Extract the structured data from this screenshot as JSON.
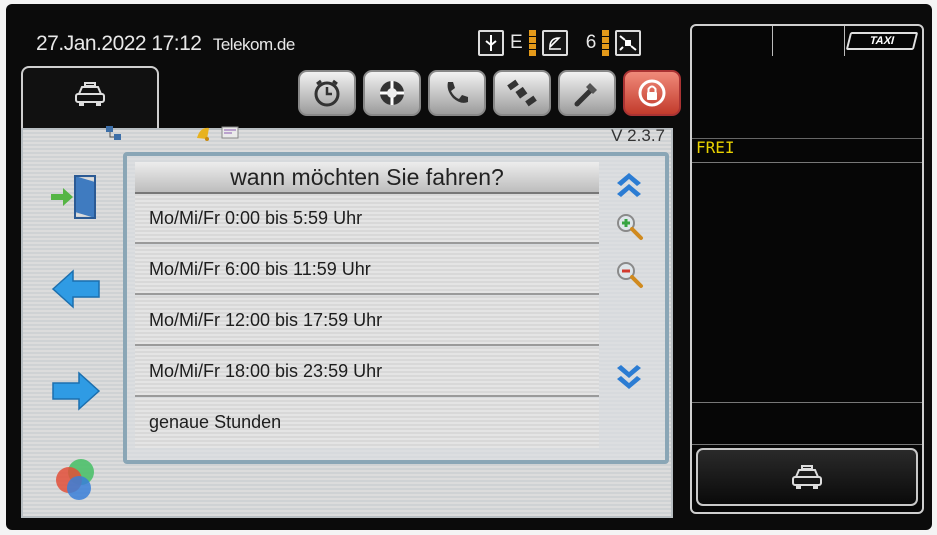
{
  "status": {
    "datetime": "27.Jan.2022 17:12",
    "carrier": "Telekom.de",
    "network_letter": "E",
    "satellite_count": "6"
  },
  "version": "V 2.3.7",
  "list": {
    "title": "wann möchten Sie fahren?",
    "items": [
      "Mo/Mi/Fr 0:00 bis 5:59 Uhr",
      "Mo/Mi/Fr 6:00 bis 11:59 Uhr",
      "Mo/Mi/Fr 12:00 bis 17:59 Uhr",
      "Mo/Mi/Fr 18:00 bis 23:59 Uhr",
      "genaue Stunden"
    ]
  },
  "right_panel": {
    "taxi_sign": "TAXI",
    "status": "FREI"
  },
  "icons": {
    "toolbar": [
      "timer-icon",
      "settings-dial-icon",
      "phone-icon",
      "satellite-icon",
      "tools-icon",
      "alarm-lock-icon"
    ],
    "side": [
      "exit-door-icon",
      "arrow-left-icon",
      "arrow-right-icon",
      "color-circles-icon"
    ],
    "scroll": [
      "scroll-up-icon",
      "zoom-in-icon",
      "zoom-out-icon",
      "scroll-down-icon"
    ]
  },
  "colors": {
    "frei_text": "#e8d100",
    "signal_bar": "#e49a1a",
    "alarm_button": "#c23b2c",
    "arrow_blue": "#2f9be4"
  }
}
